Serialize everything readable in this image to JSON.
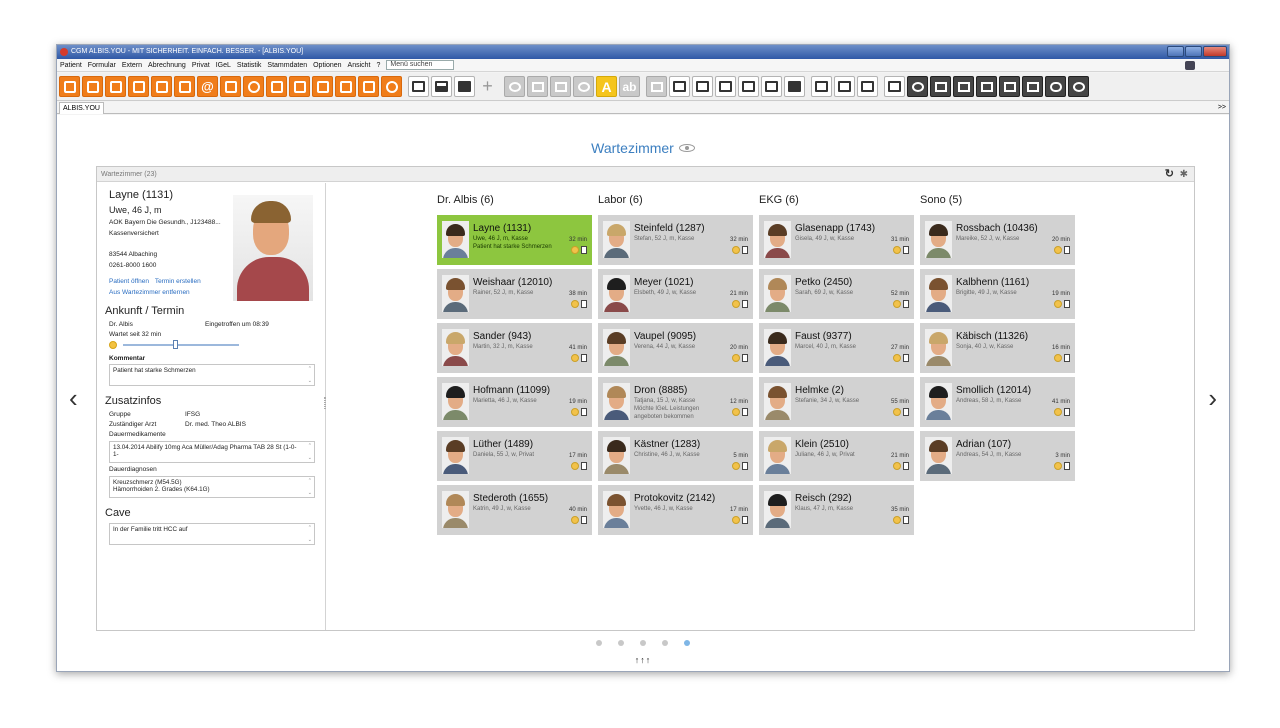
{
  "window": {
    "title": "CGM ALBIS.YOU - MIT SICHERHEIT. EINFACH. BESSER. - [ALBIS.YOU]"
  },
  "menu": {
    "items": [
      "Patient",
      "Formular",
      "Extern",
      "Abrechnung",
      "Privat",
      "IGeL",
      "Statistik",
      "Stammdaten",
      "Optionen",
      "Ansicht",
      "?"
    ],
    "search": "Menü suchen"
  },
  "tabs": {
    "active": "ALBIS.YOU",
    "more": ">>"
  },
  "toolbar": {
    "b7": "@",
    "b24": "A",
    "b25": "ab"
  },
  "page": {
    "title": "Wartezimmer"
  },
  "panel": {
    "header": "Wartezimmer (23)"
  },
  "patient": {
    "name": "Layne (1131)",
    "age_sex": "Uwe, 46 J, m",
    "insurer": "AOK Bayern Die Gesundh., J123488...",
    "insurance_type": "Kassenversichert",
    "city": "83544 Albaching",
    "phone": "0261-8000 1600",
    "link_open": "Patient öffnen",
    "link_appt": "Termin erstellen",
    "link_remove": "Aus Wartezimmer entfernen",
    "arrival_heading": "Ankunft / Termin",
    "doctor": "Dr. Albis",
    "arrived": "Eingetroffen um 08:39",
    "waiting": "Wartet seit 32 min",
    "wait_level": 0.43,
    "comment_label": "Kommentar",
    "comment": "Patient hat starke Schmerzen",
    "extra_heading": "Zusatzinfos",
    "group_label": "Gruppe",
    "group": "IFSG",
    "doctor_label": "Zuständiger Arzt",
    "doctor_full": "Dr. med. Theo ALBIS",
    "med_label": "Dauermedikamente",
    "med": "13.04.2014 Abilify 10mg Aca Müller/Adag Pharma TAB 28 St (1-0-1-",
    "diag_label": "Dauerdiagnosen",
    "diag1": "Kreuzschmerz (M54.5G)",
    "diag2": "Hämorrhoiden 2. Grades (K64.1G)",
    "cave_heading": "Cave",
    "cave": "In der Familie tritt HCC auf"
  },
  "columns": [
    {
      "title": "Dr. Albis (6)",
      "cards": [
        {
          "name": "Layne (1131)",
          "detail": "Uwe, 46 J, m, Kasse",
          "note": "Patient hat starke Schmerzen",
          "min": "32 min",
          "active": true
        },
        {
          "name": "Weishaar (12010)",
          "detail": "Rainer, 52 J, m, Kasse",
          "note": "",
          "min": "38 min"
        },
        {
          "name": "Sander (943)",
          "detail": "Martin, 32 J, m, Kasse",
          "note": "",
          "min": "41 min"
        },
        {
          "name": "Hofmann (11099)",
          "detail": "Marietta, 46 J, w, Kasse",
          "note": "",
          "min": "19 min"
        },
        {
          "name": "Lüther (1489)",
          "detail": "Daniela, 55 J, w, Privat",
          "note": "",
          "min": "17 min"
        },
        {
          "name": "Stederoth (1655)",
          "detail": "Katrin, 49 J, w, Kasse",
          "note": "",
          "min": "40 min"
        }
      ]
    },
    {
      "title": "Labor (6)",
      "cards": [
        {
          "name": "Steinfeld (1287)",
          "detail": "Stefan, 52 J, m, Kasse",
          "note": "",
          "min": "32 min"
        },
        {
          "name": "Meyer (1021)",
          "detail": "Elsbeth, 49 J, w, Kasse",
          "note": "",
          "min": "21 min"
        },
        {
          "name": "Vaupel (9095)",
          "detail": "Verena, 44 J, w, Kasse",
          "note": "",
          "min": "20 min"
        },
        {
          "name": "Dron (8885)",
          "detail": "Tatjana, 15 J, w, Kasse",
          "note": "Möchte IGeL Leistungen angeboten bekommen",
          "min": "12 min"
        },
        {
          "name": "Kästner (1283)",
          "detail": "Christine, 46 J, w, Kasse",
          "note": "",
          "min": "5 min"
        },
        {
          "name": "Protokovitz (2142)",
          "detail": "Yvette, 46 J, w, Kasse",
          "note": "",
          "min": "17 min"
        }
      ]
    },
    {
      "title": "EKG (6)",
      "cards": [
        {
          "name": "Glasenapp (1743)",
          "detail": "Gisela, 49 J, w, Kasse",
          "note": "",
          "min": "31 min"
        },
        {
          "name": "Petko (2450)",
          "detail": "Sarah, 69 J, w, Kasse",
          "note": "",
          "min": "52 min"
        },
        {
          "name": "Faust (9377)",
          "detail": "Marcel, 40 J, m, Kasse",
          "note": "",
          "min": "27 min"
        },
        {
          "name": "Helmke (2)",
          "detail": "Stefanie, 34 J, w, Kasse",
          "note": "",
          "min": "55 min"
        },
        {
          "name": "Klein (2510)",
          "detail": "Juliane, 46 J, w, Privat",
          "note": "",
          "min": "21 min"
        },
        {
          "name": "Reisch (292)",
          "detail": "Klaus, 47 J, m, Kasse",
          "note": "",
          "min": "35 min"
        }
      ]
    },
    {
      "title": "Sono (5)",
      "cards": [
        {
          "name": "Rossbach (10436)",
          "detail": "Mareike, 52 J, w, Kasse",
          "note": "",
          "min": "20 min"
        },
        {
          "name": "Kalbhenn (1161)",
          "detail": "Brigitte, 49 J, w, Kasse",
          "note": "",
          "min": "19 min"
        },
        {
          "name": "Käbisch (11326)",
          "detail": "Sonja, 40 J, w, Kasse",
          "note": "",
          "min": "16 min"
        },
        {
          "name": "Smollich (12014)",
          "detail": "Andreas, 58 J, m, Kasse",
          "note": "",
          "min": "41 min"
        },
        {
          "name": "Adrian (107)",
          "detail": "Andreas, 54 J, m, Kasse",
          "note": "",
          "min": "3 min"
        }
      ]
    }
  ],
  "pager": {
    "count": 5,
    "active": 4,
    "arrows": "↑↑↑"
  },
  "colors": {
    "accent": "#3c7fc0",
    "toolbar_orange": "#f07d1a",
    "active_card": "#8dc63f",
    "card": "#d2d2d2"
  },
  "icons": [
    "refresh-icon",
    "settings-icon",
    "eye-icon",
    "chevron-left-icon",
    "chevron-right-icon"
  ]
}
